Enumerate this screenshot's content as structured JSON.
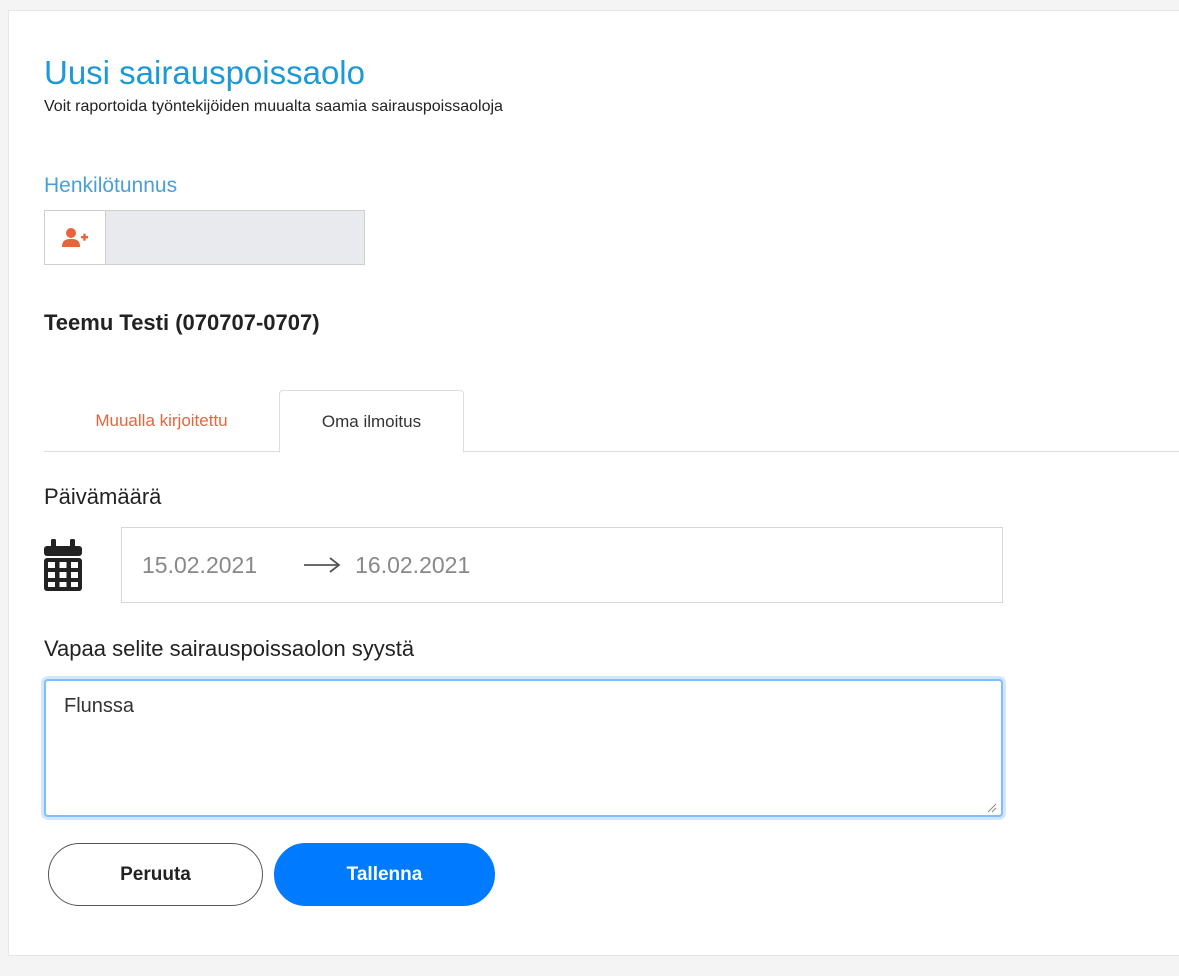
{
  "header": {
    "title": "Uusi sairauspoissaolo",
    "subtitle": "Voit raportoida työntekijöiden muualta saamia sairauspoissaoloja"
  },
  "person_id": {
    "label": "Henkilötunnus",
    "value": "",
    "add_icon": "user-plus-icon",
    "icon_color": "#e8643c"
  },
  "person": {
    "name": "Teemu Testi (070707-0707)"
  },
  "tabs": [
    {
      "label": "Muualla kirjoitettu",
      "active": false
    },
    {
      "label": "Oma ilmoitus",
      "active": true
    }
  ],
  "date": {
    "label": "Päivämäärä",
    "icon": "calendar-icon",
    "start": "15.02.2021",
    "end": "16.02.2021"
  },
  "reason": {
    "label": "Vapaa selite sairauspoissaolon syystä",
    "value": "Flunssa"
  },
  "buttons": {
    "cancel": "Peruuta",
    "save": "Tallenna"
  },
  "colors": {
    "title": "#1c9ad6",
    "accent": "#e8643c",
    "primary": "#007bff"
  }
}
